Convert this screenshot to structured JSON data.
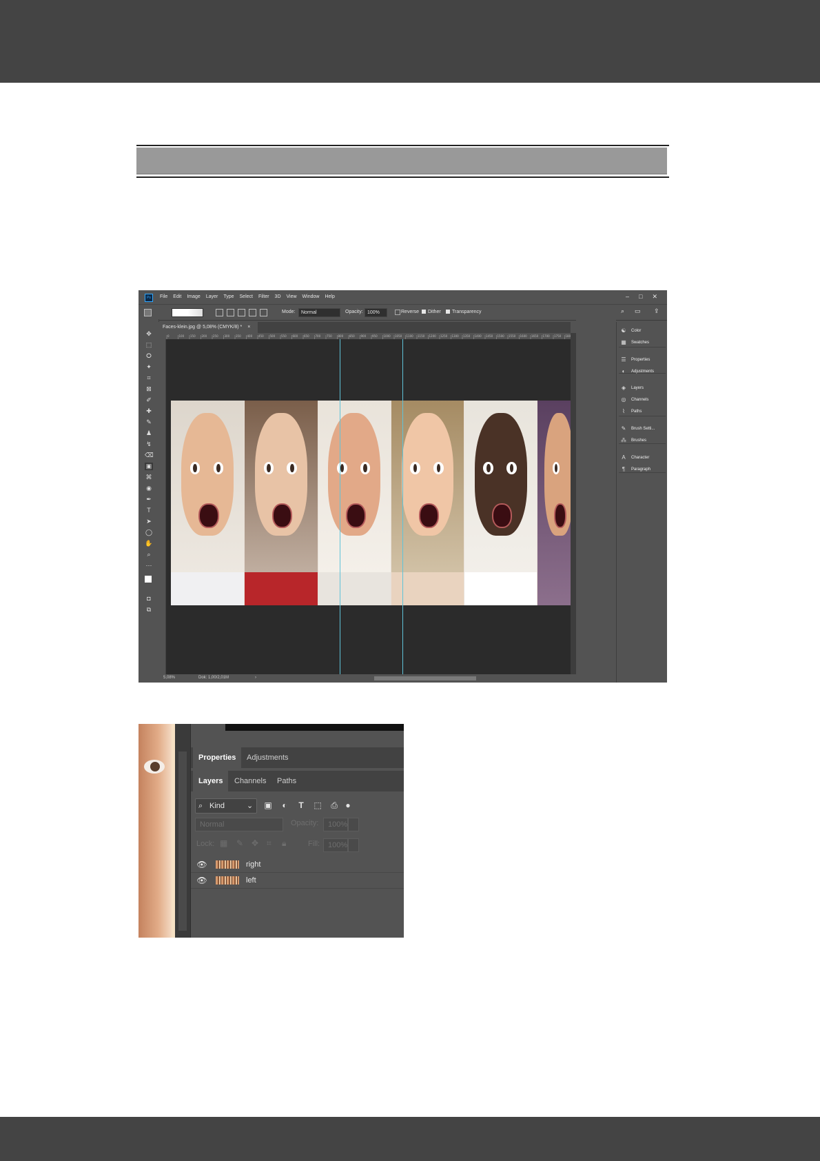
{
  "photoshop": {
    "logo": "Ps",
    "menus": [
      "File",
      "Edit",
      "Image",
      "Layer",
      "Type",
      "Select",
      "Filter",
      "3D",
      "View",
      "Window",
      "Help"
    ],
    "window_controls": [
      "–",
      "□",
      "✕"
    ],
    "options": {
      "mode_label": "Mode:",
      "mode_value": "Normal",
      "opacity_label": "Opacity:",
      "opacity_value": "100%",
      "reverse": "Reverse",
      "dither": "Dither",
      "transparency": "Transparency"
    },
    "document_tab": "Faces-klein.jpg @ 5,08% (CMYK/8) *",
    "close_tab": "×",
    "ruler_ticks": [
      "0",
      "100",
      "150",
      "200",
      "250",
      "300",
      "350",
      "400",
      "450",
      "500",
      "550",
      "600",
      "650",
      "700",
      "750",
      "800",
      "850",
      "900",
      "950",
      "1000",
      "1050",
      "1100",
      "1150",
      "1200",
      "1250",
      "1300",
      "1350",
      "1400",
      "1450",
      "1500",
      "1550",
      "1600",
      "1650",
      "1700",
      "1750",
      "1800"
    ],
    "status": {
      "zoom": "5,08%",
      "doc": "Dok: 1,00/2,01M"
    },
    "dock": [
      {
        "icon": "☯",
        "label": "Color"
      },
      {
        "icon": "▦",
        "label": "Swatches"
      },
      {
        "icon": "☰",
        "label": "Properties"
      },
      {
        "icon": "◐",
        "label": "Adjustments"
      },
      {
        "icon": "◈",
        "label": "Layers"
      },
      {
        "icon": "◎",
        "label": "Channels"
      },
      {
        "icon": "⌇",
        "label": "Paths"
      },
      {
        "icon": "✎",
        "label": "Brush Setti..."
      },
      {
        "icon": "⁂",
        "label": "Brushes"
      },
      {
        "icon": "A",
        "label": "Character"
      },
      {
        "icon": "¶",
        "label": "Paragraph"
      }
    ]
  },
  "layers_panel": {
    "tabs_top": [
      "Properties",
      "Adjustments"
    ],
    "tabs_bottom": [
      "Layers",
      "Channels",
      "Paths"
    ],
    "filter_kind": "Kind",
    "blend_mode": "Normal",
    "opacity_label": "Opacity:",
    "opacity_value": "100%",
    "lock_label": "Lock:",
    "fill_label": "Fill:",
    "fill_value": "100%",
    "layers": [
      {
        "name": "right"
      },
      {
        "name": "left"
      }
    ]
  },
  "colors": {
    "page_bar": "#444444",
    "header_fill": "#999999",
    "ps_panel": "#535353",
    "guide": "#5fc3d9"
  }
}
